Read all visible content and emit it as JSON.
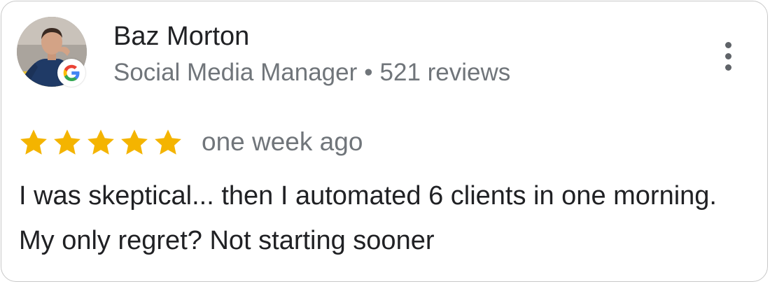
{
  "reviewer": {
    "name": "Baz Morton",
    "role": "Social Media Manager",
    "separator": "•",
    "review_count": "521 reviews"
  },
  "rating": {
    "stars": 5,
    "max_stars": 5,
    "star_color": "#f4b400"
  },
  "time_ago": "one week ago",
  "review_text": "I was skeptical... then I automated 6 clients in one morning. My only regret? Not starting sooner",
  "icons": {
    "avatar": "reviewer-photo",
    "badge": "google-g-icon",
    "menu": "more-vert-icon",
    "star": "star-icon"
  },
  "colors": {
    "text_primary": "#202124",
    "text_secondary": "#70757a",
    "google_blue": "#4285f4",
    "google_red": "#ea4335",
    "google_yellow": "#fbbc05",
    "google_green": "#34a853"
  }
}
